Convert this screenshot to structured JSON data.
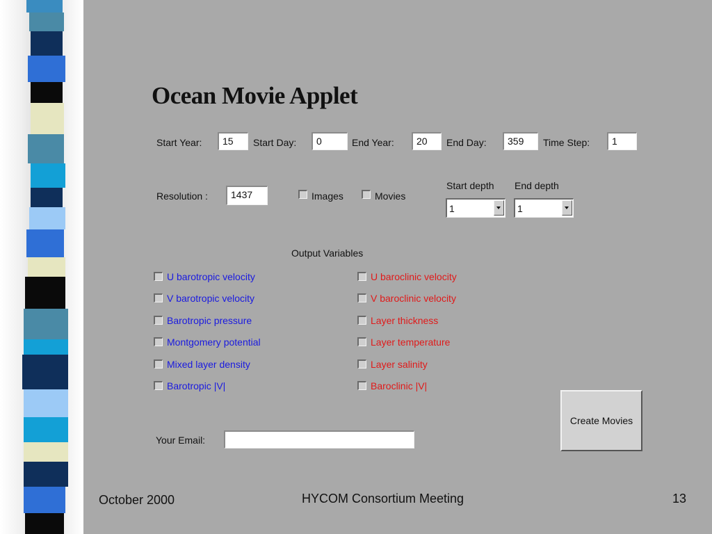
{
  "title": "Ocean Movie Applet",
  "row1": {
    "start_year_label": "Start Year:",
    "start_year_value": "15",
    "start_day_label": "Start Day:",
    "start_day_value": "0",
    "end_year_label": "End Year:",
    "end_year_value": "20",
    "end_day_label": "End Day:",
    "end_day_value": "359",
    "time_step_label": "Time Step:",
    "time_step_value": "1"
  },
  "row2": {
    "resolution_label": "Resolution :",
    "resolution_value": "1437",
    "images_label": "Images",
    "movies_label": "Movies",
    "start_depth_label": "Start depth",
    "start_depth_value": "1",
    "end_depth_label": "End depth",
    "end_depth_value": "1"
  },
  "output_variables_header": "Output Variables",
  "barotropic_vars": [
    "U barotropic velocity",
    "V barotropic velocity",
    "Barotropic pressure",
    "Montgomery potential",
    "Mixed layer density",
    "Barotropic |V|"
  ],
  "baroclinic_vars": [
    "U baroclinic velocity",
    "V baroclinic velocity",
    "Layer thickness",
    "Layer temperature",
    "Layer salinity",
    "Baroclinic |V|"
  ],
  "colors": {
    "barotropic": "#1a1ae0",
    "baroclinic": "#e01a1a",
    "background": "#a9a9a9"
  },
  "create_button_label": "Create Movies",
  "email_label": "Your Email:",
  "email_value": "",
  "footer": {
    "date": "October 2000",
    "meeting": "HYCOM Consortium Meeting",
    "page": "13"
  }
}
